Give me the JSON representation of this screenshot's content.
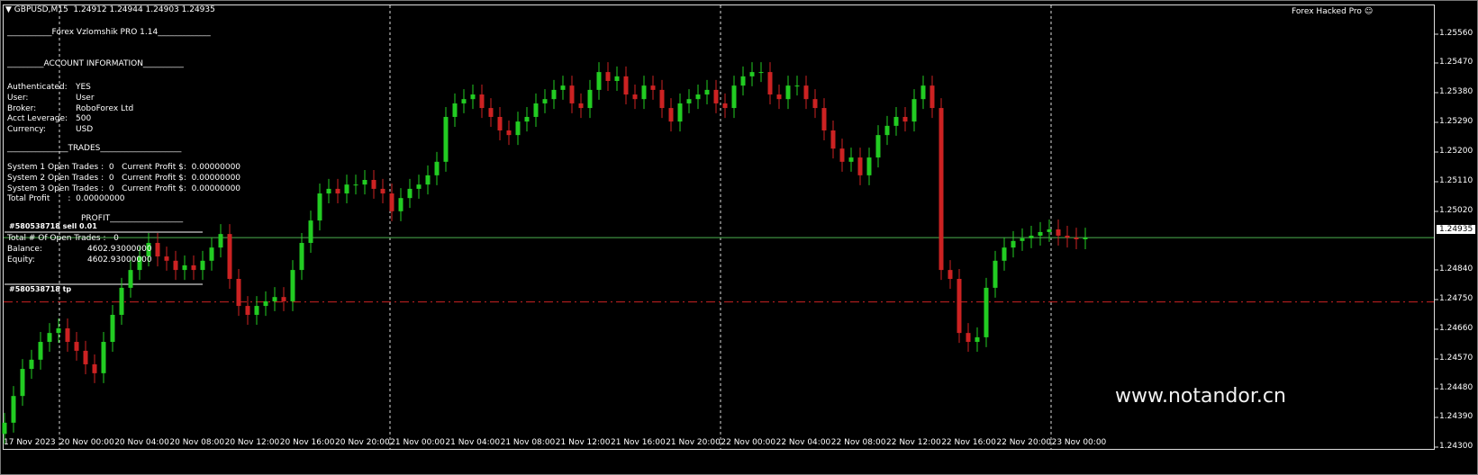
{
  "header": {
    "symbol_line": "GBPUSD,M15  1.24912 1.24944 1.24903 1.24935",
    "indicator_name": "Forex Hacked Pro",
    "indicator_icon": "smiley-icon"
  },
  "panel": {
    "title": "___________Forex Vzlomshik PRO 1.14_____________",
    "account_header": "_________ACCOUNT INFORMATION__________",
    "account": [
      {
        "label": "Authenticated:",
        "value": "YES"
      },
      {
        "label": "User:",
        "value": "User"
      },
      {
        "label": "Broker:",
        "value": "RoboForex Ltd"
      },
      {
        "label": "Acct Leverage:",
        "value": "500"
      },
      {
        "label": "Currency:",
        "value": "USD"
      }
    ],
    "trades_header": "_______________TRADES____________________",
    "systems": [
      "System 1 Open Trades :  0   Current Profit $:  0.00000000",
      "System 2 Open Trades :  0   Current Profit $:  0.00000000",
      "System 3 Open Trades :  0   Current Profit $:  0.00000000"
    ],
    "total_profit": "Total Profit       :  0.00000000",
    "profit_header": "PROFIT__________________",
    "open_trades": "Total # Of Open Trades :   0",
    "balance_label": "Balance:",
    "balance": "4602.93000000",
    "equity_label": "Equity:",
    "equity": "4602.93000000"
  },
  "orders": {
    "sell_label": "#580538718 sell 0.01",
    "tp_label": "#580538718 tp",
    "sell_price": 1.24935,
    "tp_price": 1.2474
  },
  "watermark": "www.notandor.cn",
  "colors": {
    "bull": "#22cc22",
    "bear": "#cc2222",
    "order_line": "#4caf50",
    "tp_line": "#cc2222"
  },
  "chart_data": {
    "type": "candlestick",
    "ylim": [
      1.243,
      1.256
    ],
    "current_price": "1.24935",
    "y_ticks": [
      "1.25560",
      "1.25470",
      "1.25380",
      "1.25290",
      "1.25200",
      "1.25110",
      "1.25020",
      "1.24840",
      "1.24750",
      "1.24660",
      "1.24570",
      "1.24480",
      "1.24390",
      "1.24300"
    ],
    "x_ticks": [
      "17 Nov 2023",
      "20 Nov 00:00",
      "20 Nov 04:00",
      "20 Nov 08:00",
      "20 Nov 12:00",
      "20 Nov 16:00",
      "20 Nov 20:00",
      "21 Nov 00:00",
      "21 Nov 04:00",
      "21 Nov 08:00",
      "21 Nov 12:00",
      "21 Nov 16:00",
      "21 Nov 20:00",
      "22 Nov 00:00",
      "22 Nov 04:00",
      "22 Nov 08:00",
      "22 Nov 12:00",
      "22 Nov 16:00",
      "22 Nov 20:00",
      "23 Nov 00:00"
    ],
    "closes": [
      1.24374,
      1.24455,
      1.24537,
      1.24565,
      1.24619,
      1.24646,
      1.2466,
      1.24619,
      1.24592,
      1.24551,
      1.24524,
      1.24619,
      1.24701,
      1.24783,
      1.24837,
      1.24878,
      1.24919,
      1.24878,
      1.24865,
      1.24837,
      1.24851,
      1.24837,
      1.24865,
      1.24905,
      1.24946,
      1.2481,
      1.24728,
      1.24701,
      1.24728,
      1.24742,
      1.24755,
      1.24742,
      1.24837,
      1.24919,
      1.24987,
      1.25069,
      1.25083,
      1.25069,
      1.25096,
      1.25096,
      1.2511,
      1.25083,
      1.25069,
      1.25015,
      1.25055,
      1.25083,
      1.25096,
      1.25124,
      1.25165,
      1.25301,
      1.25342,
      1.25355,
      1.25369,
      1.25328,
      1.25301,
      1.2526,
      1.25246,
      1.25287,
      1.25301,
      1.25342,
      1.25355,
      1.25383,
      1.25396,
      1.25342,
      1.25328,
      1.25383,
      1.25437,
      1.2541,
      1.25424,
      1.25369,
      1.25355,
      1.25396,
      1.25383,
      1.25328,
      1.25287,
      1.25342,
      1.25355,
      1.25369,
      1.25383,
      1.25342,
      1.25328,
      1.25396,
      1.25424,
      1.25437,
      1.25437,
      1.25369,
      1.25355,
      1.25396,
      1.25396,
      1.25355,
      1.25328,
      1.2526,
      1.25205,
      1.25165,
      1.25178,
      1.25124,
      1.25178,
      1.25246,
      1.25274,
      1.25301,
      1.25287,
      1.25355,
      1.25396,
      1.25328,
      1.24837,
      1.2481,
      1.24646,
      1.24619,
      1.24633,
      1.24783,
      1.24865,
      1.24905,
      1.24925,
      1.24933,
      1.24941,
      1.24952,
      1.2496,
      1.24941,
      1.24935,
      1.2493,
      1.24935
    ]
  }
}
